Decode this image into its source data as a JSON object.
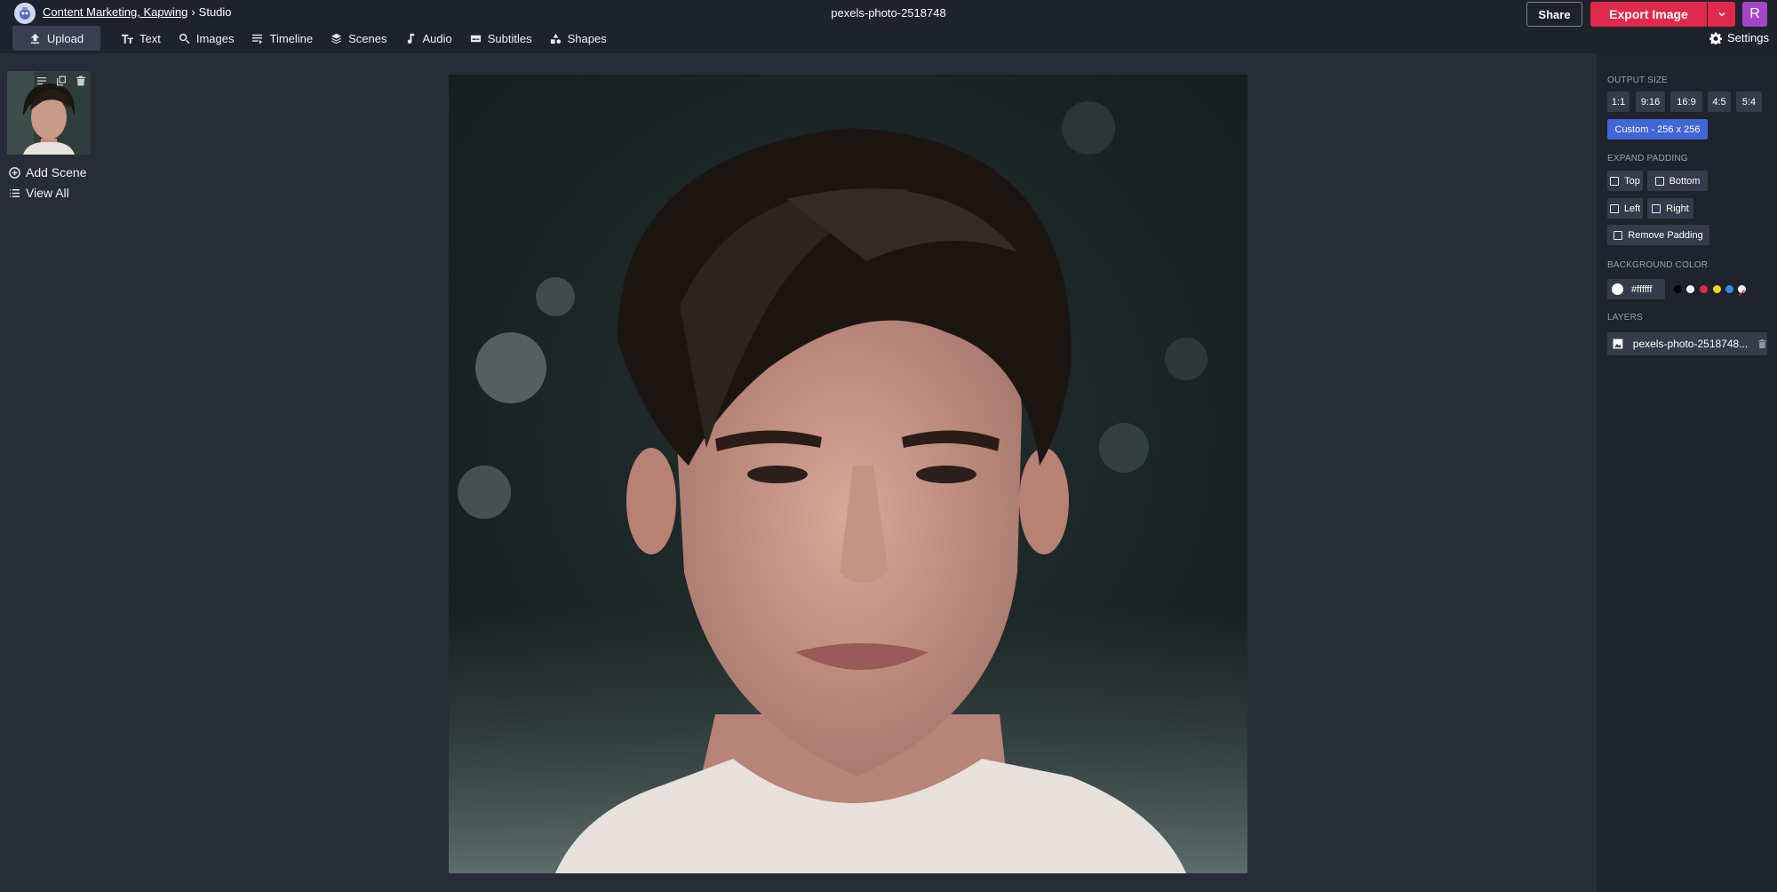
{
  "header": {
    "breadcrumb_link": "Content Marketing, Kapwing",
    "breadcrumb_sep": "›",
    "breadcrumb_current": "Studio",
    "title": "pexels-photo-2518748",
    "share_label": "Share",
    "export_label": "Export Image",
    "avatar_initial": "R"
  },
  "toolbar": {
    "items": [
      {
        "label": "Upload",
        "icon": "upload-icon"
      },
      {
        "label": "Text",
        "icon": "text-icon"
      },
      {
        "label": "Images",
        "icon": "search-icon"
      },
      {
        "label": "Timeline",
        "icon": "timeline-icon"
      },
      {
        "label": "Scenes",
        "icon": "layers-icon"
      },
      {
        "label": "Audio",
        "icon": "music-note-icon"
      },
      {
        "label": "Subtitles",
        "icon": "subtitles-icon"
      },
      {
        "label": "Shapes",
        "icon": "shapes-icon"
      }
    ],
    "settings_label": "Settings"
  },
  "scenes": {
    "add_label": "Add Scene",
    "view_all_label": "View All"
  },
  "right_panel": {
    "output_size_title": "OUTPUT SIZE",
    "sizes": [
      "1:1",
      "9:16",
      "16:9",
      "4:5",
      "5:4"
    ],
    "custom_size": "Custom - 256 x 256",
    "expand_padding_title": "EXPAND PADDING",
    "padding": {
      "top": "Top",
      "bottom": "Bottom",
      "left": "Left",
      "right": "Right",
      "remove": "Remove Padding"
    },
    "background_title": "BACKGROUND COLOR",
    "background_value": "#ffffff",
    "swatches": [
      "#000000",
      "#ffffff",
      "#e0294c",
      "#f5d21b",
      "#2f8fe6"
    ],
    "layers_title": "LAYERS",
    "layer_name": "pexels-photo-2518748..."
  },
  "colors": {
    "accent_export": "#e0294c",
    "accent_custom": "#4166d5",
    "avatar": "#a446c9"
  }
}
